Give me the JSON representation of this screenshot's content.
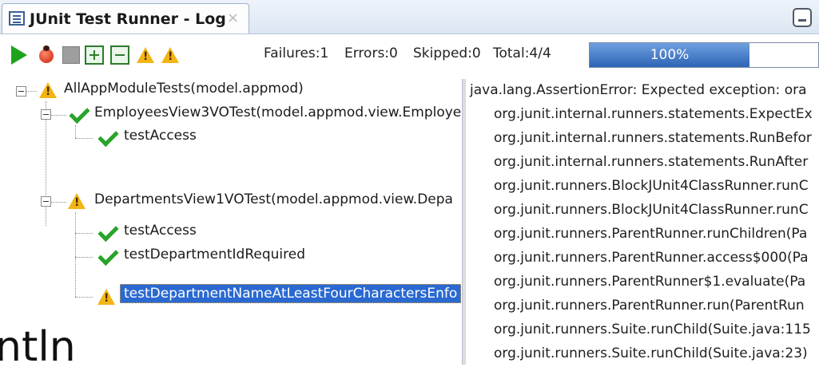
{
  "tab": {
    "title": "JUnit Test Runner - Log",
    "close": "×"
  },
  "toolbar": {
    "failures": "Failures:1",
    "errors": "Errors:0",
    "skipped": "Skipped:0",
    "total": "Total:4/4",
    "progress_label": "100%",
    "progress_value": 1.0
  },
  "tree": [
    {
      "label": "AllAppModuleTests(model.appmod)",
      "status": "warning"
    },
    {
      "label": "EmployeesView3VOTest(model.appmod.view.Employe",
      "status": "pass"
    },
    {
      "label": "testAccess",
      "status": "pass"
    },
    {
      "label": "DepartmentsView1VOTest(model.appmod.view.Depa",
      "status": "warning"
    },
    {
      "label": "testAccess",
      "status": "pass"
    },
    {
      "label": "testDepartmentIdRequired",
      "status": "pass"
    },
    {
      "label": "testDepartmentNameAtLeastFourCharactersEnfo",
      "status": "warning"
    }
  ],
  "log": [
    "java.lang.AssertionError: Expected exception: ora",
    "org.junit.internal.runners.statements.ExpectEx",
    "org.junit.internal.runners.statements.RunBefor",
    "org.junit.internal.runners.statements.RunAfter",
    "org.junit.runners.BlockJUnit4ClassRunner.runC",
    "org.junit.runners.BlockJUnit4ClassRunner.runC",
    "org.junit.runners.ParentRunner.runChildren(Pa",
    "org.junit.runners.ParentRunner.access$000(Pa",
    "org.junit.runners.ParentRunner$1.evaluate(Pa",
    "org.junit.runners.ParentRunner.run(ParentRun",
    "org.junit.runners.Suite.runChild(Suite.java:115",
    "org.junit.runners.Suite.runChild(Suite.java:23)"
  ],
  "overlay_text": "ntln",
  "colors": {
    "accent": "#2a69d1",
    "pass": "#29a329",
    "warning": "#f3b514",
    "progress": "#2d64b4"
  }
}
